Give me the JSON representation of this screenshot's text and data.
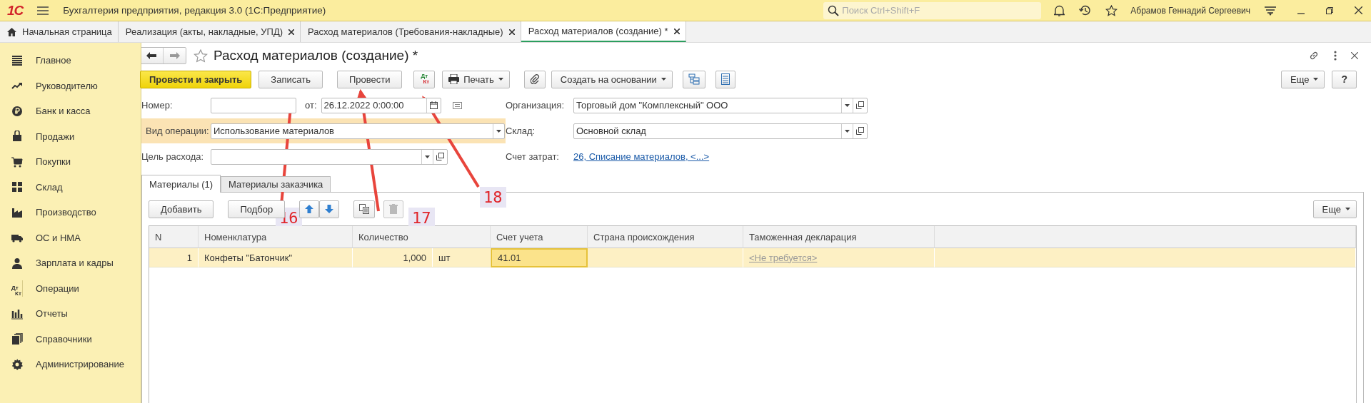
{
  "window": {
    "logo": "1С",
    "title": "Бухгалтерия предприятия, редакция 3.0  (1С:Предприятие)",
    "search_placeholder": "Поиск Ctrl+Shift+F",
    "user": "Абрамов Геннадий Сергеевич"
  },
  "open_tabs": [
    {
      "label": "Начальная страница",
      "kind": "home",
      "selected": false
    },
    {
      "label": "Реализация (акты, накладные, УПД)",
      "kind": "doc",
      "selected": false
    },
    {
      "label": "Расход материалов (Требования-накладные)",
      "kind": "doc",
      "selected": false
    },
    {
      "label": "Расход материалов (создание) *",
      "kind": "doc",
      "selected": true
    }
  ],
  "sidebar": {
    "items": [
      {
        "label": "Главное",
        "kind": "lines"
      },
      {
        "label": "Руководителю",
        "kind": "trend"
      },
      {
        "label": "Банк и касса",
        "kind": "coin"
      },
      {
        "label": "Продажи",
        "kind": "bag"
      },
      {
        "label": "Покупки",
        "kind": "cart"
      },
      {
        "label": "Склад",
        "kind": "grid"
      },
      {
        "label": "Производство",
        "kind": "factory"
      },
      {
        "label": "ОС и НМА",
        "kind": "truck"
      },
      {
        "label": "Зарплата и кадры",
        "kind": "person"
      },
      {
        "label": "Операции",
        "kind": "dtkt",
        "icon_text": [
          "Дт",
          "Кт"
        ]
      },
      {
        "label": "Отчеты",
        "kind": "bars"
      },
      {
        "label": "Справочники",
        "kind": "books"
      },
      {
        "label": "Администрирование",
        "kind": "gear"
      }
    ]
  },
  "form": {
    "title": "Расход материалов (создание) *",
    "toolbar": [
      {
        "kind": "primary",
        "label": "Провести и закрыть"
      },
      {
        "kind": "button",
        "label": "Записать"
      },
      {
        "kind": "button",
        "label": "Провести"
      },
      {
        "kind": "dtkt",
        "icon_text": [
          "Дт",
          "Кт"
        ]
      },
      {
        "kind": "print",
        "label": "Печать"
      },
      {
        "kind": "clip"
      },
      {
        "kind": "menu",
        "label": "Создать на основании"
      },
      {
        "kind": "structure"
      },
      {
        "kind": "list"
      }
    ],
    "more": "Еще",
    "help": "?",
    "number": {
      "label": "Номер:"
    },
    "date": {
      "label": "от:",
      "value": "26.12.2022  0:00:00"
    },
    "operation": {
      "label": "Вид операции:",
      "value": "Использование материалов"
    },
    "purpose": {
      "label": "Цель расхода:"
    },
    "organization": {
      "label": "Организация:",
      "value": "Торговый дом \"Комплексный\" ООО"
    },
    "warehouse": {
      "label": "Склад:",
      "value": "Основной склад"
    },
    "cost_account": {
      "label": "Счет затрат:",
      "value": "26, Списание материалов, <...>"
    },
    "tabs": [
      {
        "label": "Материалы (1)",
        "selected": true
      },
      {
        "label": "Материалы заказчика",
        "selected": false
      }
    ],
    "table_toolbar": [
      {
        "kind": "button",
        "label": "Добавить"
      },
      {
        "kind": "button",
        "label": "Подбор"
      },
      {
        "kind": "up"
      },
      {
        "kind": "down"
      },
      {
        "kind": "copy"
      },
      {
        "kind": "delete",
        "disabled": true
      }
    ],
    "table_more": "Еще",
    "table": {
      "columns": [
        {
          "label": "N"
        },
        {
          "label": "Номенклатура"
        },
        {
          "label": "Количество"
        },
        {
          "label": "Счет учета"
        },
        {
          "label": "Страна происхождения"
        },
        {
          "label": "Таможенная декларация"
        }
      ],
      "rows": [
        {
          "selected": true,
          "cells": [
            {
              "text": "1"
            },
            {
              "text": "Конфеты \"Батончик\""
            },
            {
              "text": "1,000",
              "unit": "шт"
            },
            {
              "text": "41.01",
              "focused": true
            },
            {},
            {
              "text": "<Не требуется>",
              "kind": "placeholder"
            }
          ]
        }
      ]
    }
  },
  "annotations": [
    {
      "number": "16"
    },
    {
      "number": "17"
    },
    {
      "number": "18"
    }
  ]
}
